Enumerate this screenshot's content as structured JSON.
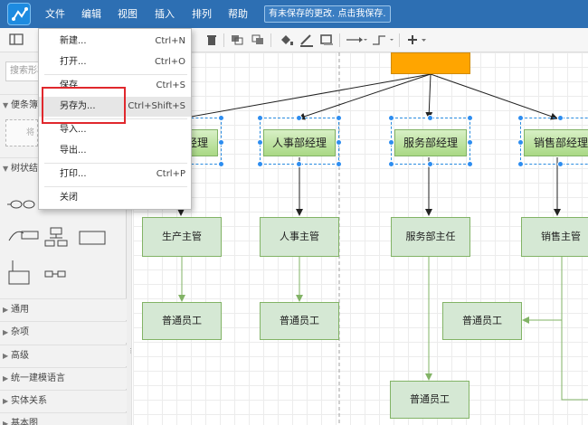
{
  "menubar": {
    "items": [
      {
        "label": "文件"
      },
      {
        "label": "编辑"
      },
      {
        "label": "视图"
      },
      {
        "label": "插入"
      },
      {
        "label": "排列"
      },
      {
        "label": "帮助"
      }
    ],
    "save_hint": "有未保存的更改. 点击我保存."
  },
  "sidebar": {
    "search_placeholder": "搜索形状",
    "scratchpad": {
      "label": "便条簿",
      "hint": "将"
    },
    "tree_section": {
      "label": "树状结"
    },
    "sections": [
      {
        "label": "通用"
      },
      {
        "label": "杂项"
      },
      {
        "label": "高级"
      },
      {
        "label": "统一建模语言"
      },
      {
        "label": "实体关系"
      },
      {
        "label": "基本图"
      }
    ]
  },
  "file_menu": {
    "items": [
      {
        "label": "新建...",
        "shortcut": "Ctrl+N"
      },
      {
        "label": "打开...",
        "shortcut": "Ctrl+O"
      },
      {
        "label": "保存",
        "shortcut": "Ctrl+S"
      },
      {
        "label": "另存为...",
        "shortcut": "Ctrl+Shift+S"
      },
      {
        "label": "导入...",
        "shortcut": ""
      },
      {
        "label": "导出...",
        "shortcut": ""
      },
      {
        "label": "打印...",
        "shortcut": "Ctrl+P"
      },
      {
        "label": "关闭",
        "shortcut": ""
      }
    ]
  },
  "diagram": {
    "managers": [
      {
        "label": "生产部经理"
      },
      {
        "label": "人事部经理"
      },
      {
        "label": "服务部经理"
      },
      {
        "label": "销售部经理"
      }
    ],
    "supervisors": [
      {
        "label": "生产主管"
      },
      {
        "label": "人事主管"
      },
      {
        "label": "服务部主任"
      },
      {
        "label": "销售主管"
      }
    ],
    "employees": [
      {
        "label": "普通员工"
      },
      {
        "label": "普通员工"
      },
      {
        "label": "普通员工"
      },
      {
        "label": "普通员工"
      }
    ],
    "colors": {
      "root_fill": "#ffa500",
      "node_fill": "#d5e8d4",
      "node_border": "#82b366",
      "selection": "#2a8ce0",
      "highlight": "#e0282d"
    }
  }
}
